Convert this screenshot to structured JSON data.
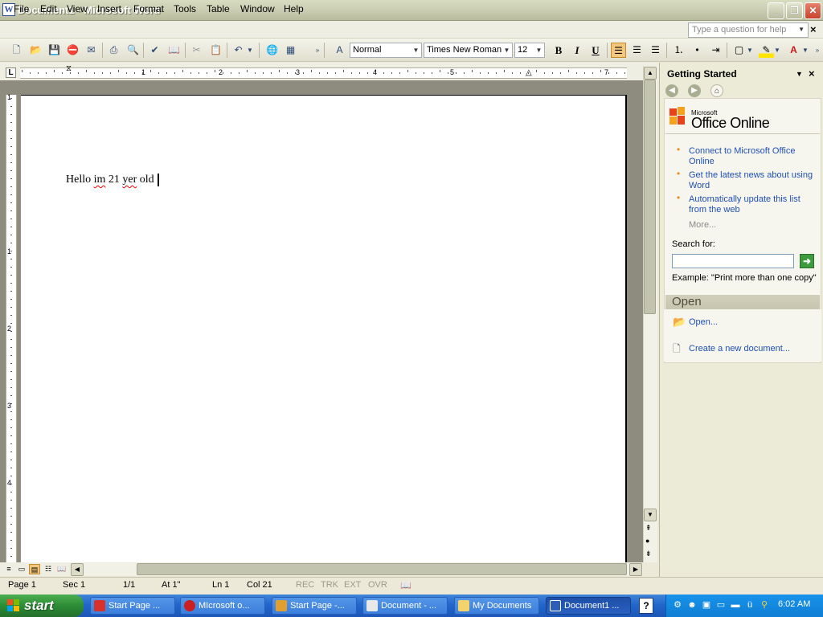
{
  "window": {
    "title": "Document1 - Microsoft Word",
    "app_icon": "W",
    "minimize": "_",
    "maximize": "❐",
    "close": "✕"
  },
  "menu": {
    "items": [
      "File",
      "Edit",
      "View",
      "Insert",
      "Format",
      "Tools",
      "Table",
      "Window",
      "Help"
    ],
    "ask_placeholder": "Type a question for help",
    "close": "×"
  },
  "toolbar": {
    "style": "Normal",
    "font": "Times New Roman",
    "size": "12",
    "bold": "B",
    "italic": "I",
    "underline": "U"
  },
  "ruler": {
    "corner": "L",
    "numbers": [
      "1",
      "1",
      "2",
      "3",
      "4",
      "5",
      "6",
      "7"
    ],
    "vertical_numbers": [
      "1",
      "1",
      "2",
      "3",
      "4"
    ]
  },
  "document": {
    "words": [
      "Hello",
      "im",
      "21",
      "yer",
      "old"
    ]
  },
  "task_pane": {
    "title": "Getting Started",
    "logo_small": "Microsoft",
    "logo": "Office Online",
    "links": [
      "Connect to Microsoft Office Online",
      "Get the latest news about using Word",
      "Automatically update this list from the web"
    ],
    "more": "More...",
    "search_label": "Search for:",
    "search_value": "",
    "example": "Example:  \"Print more than one copy\"",
    "open_header": "Open",
    "open_link": "Open...",
    "new_link": "Create a new document..."
  },
  "status_bar": {
    "page": "Page  1",
    "section": "Sec  1",
    "pages": "1/1",
    "at": "At  1\"",
    "line": "Ln  1",
    "col": "Col  21",
    "rec": "REC",
    "trk": "TRK",
    "ext": "EXT",
    "ovr": "OVR"
  },
  "taskbar": {
    "start": "start",
    "tasks": [
      {
        "label": "Start Page ...",
        "icon_color": "#d9312b"
      },
      {
        "label": "MIcrosoft o...",
        "icon_color": "#cc1f1f"
      },
      {
        "label": "Start Page -...",
        "icon_color": "#e0a030"
      },
      {
        "label": "Document - ...",
        "icon_color": "#e8e8e8"
      },
      {
        "label": "My Documents",
        "icon_color": "#f3d36a"
      },
      {
        "label": "Document1 ...",
        "icon_color": "#2b5fb8"
      }
    ],
    "help": "?",
    "clock": "6:02 AM"
  },
  "colors": {
    "link": "#1f4fb8",
    "bullet": "#f08a1e",
    "taskbar": "#2266cc",
    "start": "#2c8c35"
  }
}
